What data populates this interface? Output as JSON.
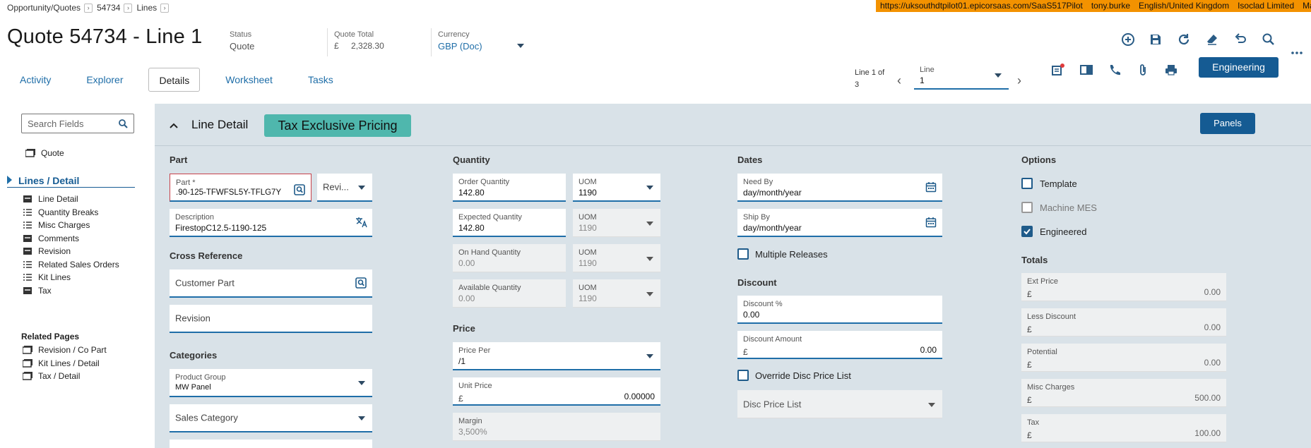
{
  "breadcrumb": [
    {
      "label": "Opportunity/Quotes"
    },
    {
      "label": "54734"
    },
    {
      "label": "Lines"
    }
  ],
  "env": {
    "url": "https://uksouthdtpilot01.epicorsaas.com/SaaS517Pilot",
    "user": "tony.burke",
    "locale": "English/United Kingdom",
    "company": "Isoclad Limited",
    "site": "Main Site"
  },
  "header": {
    "title": "Quote 54734 - Line 1",
    "status_label": "Status",
    "status_value": "Quote",
    "total_label": "Quote Total",
    "total_currency": "£",
    "total_value": "2,328.30",
    "currency_label": "Currency",
    "currency_value": "GBP (Doc)"
  },
  "toolbar_icons": [
    "add-icon",
    "save-icon",
    "refresh-icon",
    "clear-icon",
    "undo-icon",
    "search-icon",
    "more-icon"
  ],
  "tabs": [
    {
      "label": "Activity",
      "active": false
    },
    {
      "label": "Explorer",
      "active": false
    },
    {
      "label": "Details",
      "active": true
    },
    {
      "label": "Worksheet",
      "active": false
    },
    {
      "label": "Tasks",
      "active": false
    }
  ],
  "line_nav": {
    "position_text": "Line 1 of 3",
    "line_label": "Line",
    "line_value": "1"
  },
  "engineering_button": "Engineering",
  "left_nav": {
    "search_placeholder": "Search Fields",
    "quote": "Quote",
    "section": "Lines / Detail",
    "items": [
      "Line Detail",
      "Quantity Breaks",
      "Misc Charges",
      "Comments",
      "Revision",
      "Related Sales Orders",
      "Kit Lines",
      "Tax"
    ],
    "related_title": "Related Pages",
    "related": [
      "Revision / Co Part",
      "Kit Lines / Detail",
      "Tax / Detail"
    ]
  },
  "panel": {
    "title": "Line Detail",
    "tag": "Tax Exclusive Pricing",
    "panels_button": "Panels"
  },
  "part": {
    "section": "Part",
    "part_label": "Part *",
    "part_value": ".90-125-TFWFSL5Y-TFLG7Y",
    "revision_placeholder": "Revi...",
    "desc_label": "Description",
    "desc_value": "FirestopC12.5-1190-125",
    "xref_section": "Cross Reference",
    "customer_part": "Customer Part",
    "revision": "Revision",
    "categories_section": "Categories",
    "product_group_label": "Product Group",
    "product_group_value": "MW Panel",
    "sales_category": "Sales Category"
  },
  "quantity": {
    "section": "Quantity",
    "rows": [
      {
        "label": "Order Quantity",
        "value": "142.80",
        "uom_label": "UOM",
        "uom": "1190",
        "readonly": false,
        "uom_readonly": false
      },
      {
        "label": "Expected Quantity",
        "value": "142.80",
        "uom_label": "UOM",
        "uom": "1190",
        "readonly": false,
        "uom_readonly": true
      },
      {
        "label": "On Hand Quantity",
        "value": "0.00",
        "uom_label": "UOM",
        "uom": "1190",
        "readonly": true,
        "uom_readonly": true
      },
      {
        "label": "Available Quantity",
        "value": "0.00",
        "uom_label": "UOM",
        "uom": "1190",
        "readonly": true,
        "uom_readonly": true
      }
    ],
    "price_section": "Price",
    "price_per_label": "Price Per",
    "price_per_value": "/1",
    "unit_price_label": "Unit Price",
    "unit_price_currency": "£",
    "unit_price_value": "0.00000",
    "margin_label": "Margin",
    "margin_value": "3,500%"
  },
  "dates": {
    "section": "Dates",
    "need_by_label": "Need By",
    "need_by_value": "day/month/year",
    "ship_by_label": "Ship By",
    "ship_by_value": "day/month/year",
    "multiple_releases": "Multiple Releases",
    "discount_section": "Discount",
    "discount_pct_label": "Discount %",
    "discount_pct_value": "0.00",
    "discount_amount_label": "Discount Amount",
    "discount_amount_currency": "£",
    "discount_amount_value": "0.00",
    "override_disc": "Override Disc Price List",
    "disc_price_list": "Disc Price List"
  },
  "options": {
    "section": "Options",
    "template": "Template",
    "machine_mes": "Machine MES",
    "engineered": "Engineered"
  },
  "totals": {
    "section": "Totals",
    "currency": "£",
    "rows": [
      {
        "label": "Ext Price",
        "value": "0.00"
      },
      {
        "label": "Less Discount",
        "value": "0.00"
      },
      {
        "label": "Potential",
        "value": "0.00"
      },
      {
        "label": "Misc Charges",
        "value": "500.00"
      },
      {
        "label": "Tax",
        "value": "100.00"
      }
    ]
  }
}
